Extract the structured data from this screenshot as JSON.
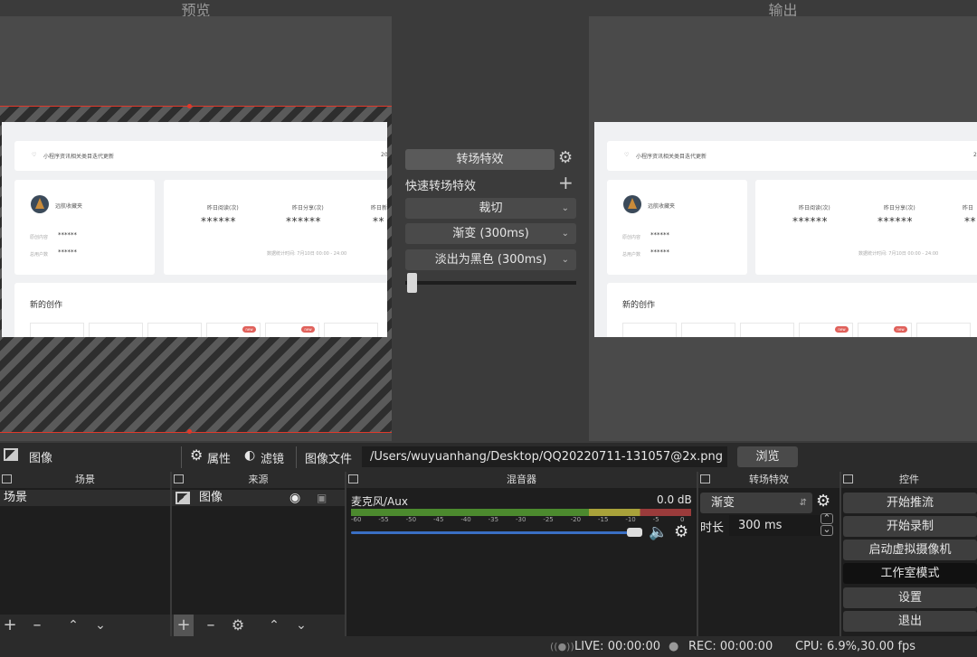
{
  "preview": {
    "title": "预览",
    "page": {
      "notice": "小程序资讯相关类目迭代更新",
      "notice_cut": "20",
      "account_name": "远航收藏夹",
      "row1_label": "原创内容",
      "row2_label": "总用户数",
      "masked": "******",
      "stat1": "昨日阅读(次)",
      "stat2": "昨日分享(次)",
      "stat3": "昨日新",
      "stat_masked": "******",
      "stat3_masked": "**",
      "update_note": "数据统计时间: 7月10日 00:00 - 24:00",
      "section": "新的创作",
      "new_tag": "new"
    }
  },
  "program": {
    "title": "输出",
    "page": {
      "notice": "小程序资讯相关类目迭代更新",
      "notice_cut": "2",
      "account_name": "远航收藏夹",
      "row1_label": "原创内容",
      "row2_label": "总用户数",
      "masked": "******",
      "stat1": "昨日阅读(次)",
      "stat2": "昨日分享(次)",
      "stat3": "昨日",
      "stat_masked": "******",
      "stat3_masked": "**",
      "update_note": "数据统计时间: 7月10日 00:00 - 24:00",
      "section": "新的创作",
      "new_tag": "new"
    }
  },
  "transition_panel": {
    "transition_button": "转场特效",
    "quick_label": "快速转场特效",
    "items": [
      "裁切",
      "渐变 (300ms)",
      "淡出为黑色 (300ms)"
    ],
    "tbar_position": 0
  },
  "source_toolbar": {
    "source_name": "图像",
    "properties": "属性",
    "filters": "滤镜",
    "image_file_label": "图像文件",
    "path": "/Users/wuyuanhang/Desktop/QQ20220711-131057@2x.png",
    "browse": "浏览"
  },
  "scenes": {
    "title": "场景",
    "items": [
      "场景"
    ]
  },
  "sources": {
    "title": "来源",
    "items": [
      "图像"
    ]
  },
  "mixer": {
    "title": "混音器",
    "channel": "麦克风/Aux",
    "level": "0.0 dB",
    "ticks": [
      "-60",
      "-55",
      "-50",
      "-45",
      "-40",
      "-35",
      "-30",
      "-25",
      "-20",
      "-15",
      "-10",
      "-5",
      "0"
    ],
    "volume": 1.0
  },
  "transitions_dock": {
    "title": "转场特效",
    "selected": "渐变",
    "duration_label": "时长",
    "duration_value": "300 ms"
  },
  "controls": {
    "title": "控件",
    "buttons": [
      "开始推流",
      "开始录制",
      "启动虚拟摄像机",
      "工作室模式",
      "设置",
      "退出"
    ]
  },
  "status": {
    "live": "LIVE: 00:00:00",
    "rec": "REC: 00:00:00",
    "cpu": "CPU: 6.9%,30.00 fps"
  }
}
